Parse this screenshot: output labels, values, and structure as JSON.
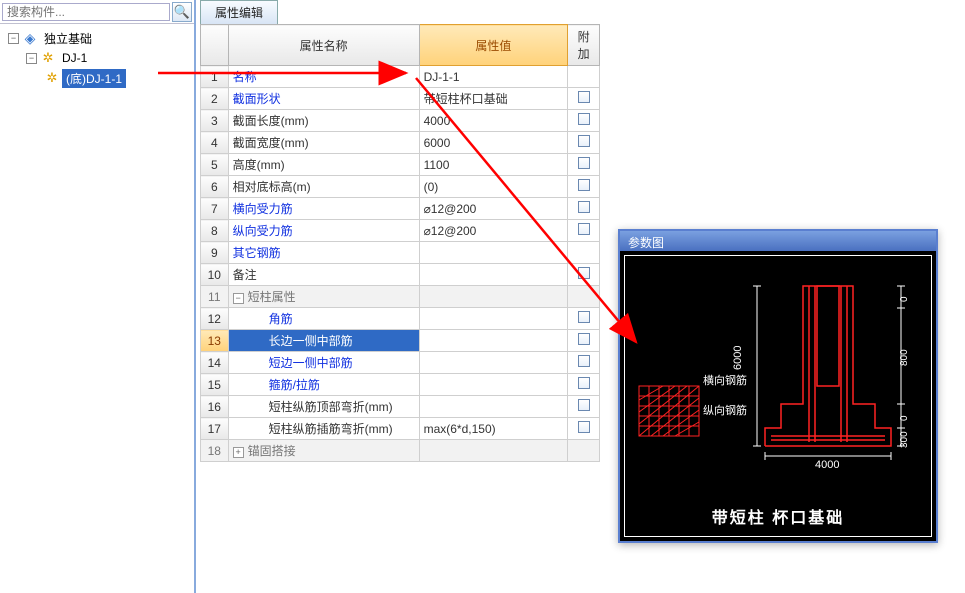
{
  "search": {
    "placeholder": "搜索构件..."
  },
  "tree": {
    "root": {
      "label": "独立基础"
    },
    "child": {
      "label": "DJ-1"
    },
    "leaf": {
      "label": "(底)DJ-1-1"
    }
  },
  "tab": "属性编辑",
  "headers": {
    "name": "属性名称",
    "value": "属性值",
    "extra": "附加"
  },
  "rows": [
    {
      "n": 1,
      "name": "名称",
      "val": "DJ-1-1",
      "link": true,
      "chk": false
    },
    {
      "n": 2,
      "name": "截面形状",
      "val": "带短柱杯口基础",
      "link": true,
      "chk": true
    },
    {
      "n": 3,
      "name": "截面长度(mm)",
      "val": "4000",
      "link": false,
      "chk": true
    },
    {
      "n": 4,
      "name": "截面宽度(mm)",
      "val": "6000",
      "link": false,
      "chk": true
    },
    {
      "n": 5,
      "name": "高度(mm)",
      "val": "1100",
      "link": false,
      "chk": true
    },
    {
      "n": 6,
      "name": "相对底标高(m)",
      "val": "(0)",
      "link": false,
      "chk": true
    },
    {
      "n": 7,
      "name": "横向受力筋",
      "val": "⌀12@200",
      "link": true,
      "chk": true
    },
    {
      "n": 8,
      "name": "纵向受力筋",
      "val": "⌀12@200",
      "link": true,
      "chk": true
    },
    {
      "n": 9,
      "name": "其它钢筋",
      "val": "",
      "link": true,
      "chk": false
    },
    {
      "n": 10,
      "name": "备注",
      "val": "",
      "link": false,
      "chk": true
    }
  ],
  "section": {
    "n": 11,
    "label": "短柱属性"
  },
  "subrows": [
    {
      "n": 12,
      "name": "角筋",
      "link": true,
      "chk": true
    },
    {
      "n": 13,
      "name": "长边一侧中部筋",
      "link": true,
      "chk": true,
      "sel": true
    },
    {
      "n": 14,
      "name": "短边一侧中部筋",
      "link": true,
      "chk": true
    },
    {
      "n": 15,
      "name": "箍筋/拉筋",
      "link": true,
      "chk": true
    },
    {
      "n": 16,
      "name": "短柱纵筋顶部弯折(mm)",
      "link": false,
      "chk": true
    },
    {
      "n": 17,
      "name": "短柱纵筋插筋弯折(mm)",
      "val": "max(6*d,150)",
      "link": false,
      "chk": true
    }
  ],
  "section2": {
    "n": 18,
    "label": "锚固搭接"
  },
  "param": {
    "title": "参数图",
    "caption": "带短柱 杯口基础",
    "hlabel": "横向钢筋",
    "vlabel": "纵向钢筋",
    "dim_w": "4000",
    "dim_h": "6000",
    "dim_800": "800",
    "dim_300": "300",
    "dim_0a": "0",
    "dim_0b": "0"
  }
}
